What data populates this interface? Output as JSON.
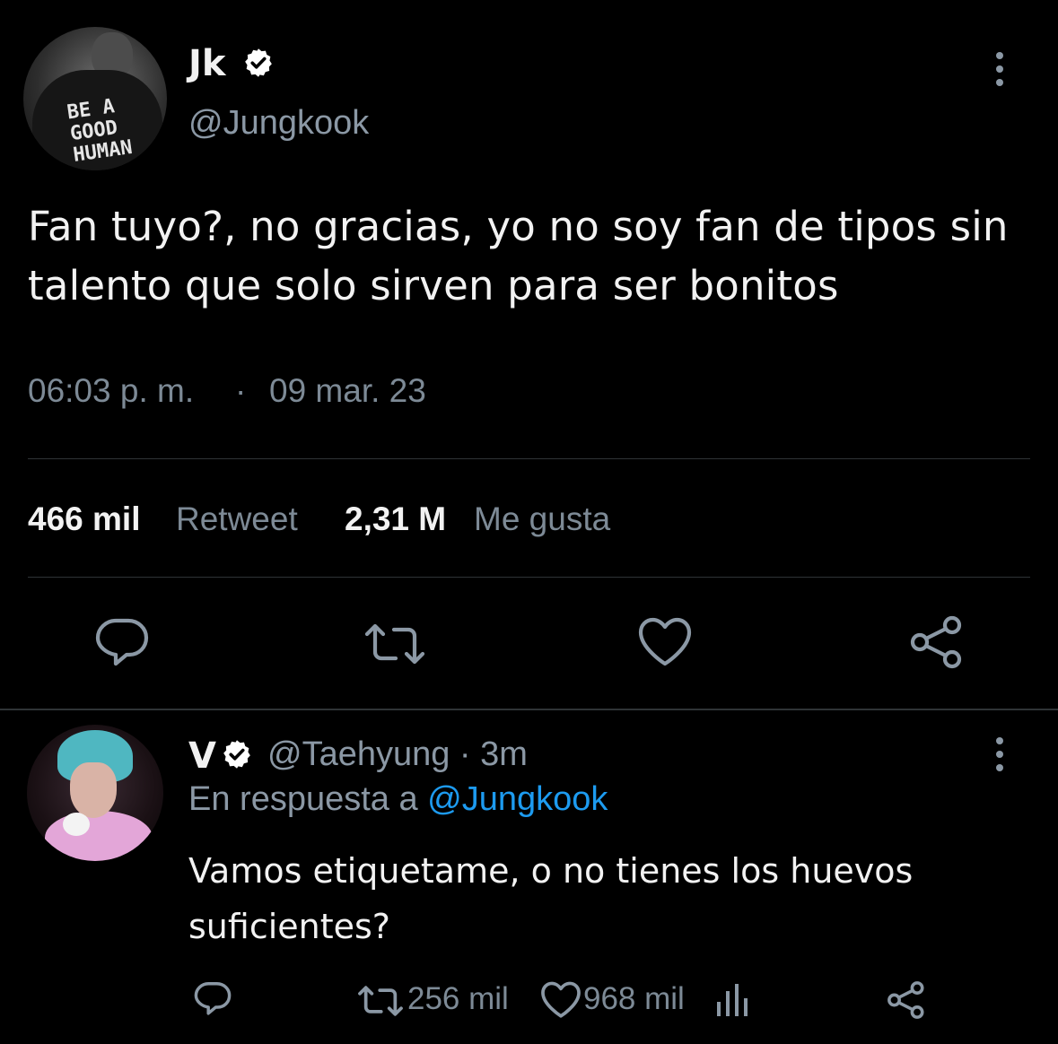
{
  "main_tweet": {
    "display_name": "Jk",
    "handle": "@Jungkook",
    "avatar_shirt_text": "BE A GOOD HUMAN",
    "text": "Fan tuyo?, no gracias, yo no soy fan de tipos sin talento que solo sirven para ser bonitos",
    "time": "06:03 p. m.",
    "separator": "·",
    "date": "09 mar. 23",
    "stats": {
      "retweets_count": "466 mil",
      "retweets_label": "Retweet",
      "likes_count": "2,31 M",
      "likes_label": "Me gusta"
    },
    "actions": [
      "reply-icon",
      "retweet-icon",
      "like-icon",
      "share-icon"
    ]
  },
  "reply_tweet": {
    "display_name": "V",
    "handle_time": "@Taehyung · 3m",
    "reply_prefix": "En respuesta a",
    "reply_to": "@Jungkook",
    "text": "Vamos etiquetame, o no tienes los huevos suficientes?",
    "retweets": "256 mil",
    "likes": "968 mil",
    "actions": [
      "reply-icon",
      "retweet-icon",
      "like-icon",
      "analytics-icon",
      "share-icon"
    ]
  },
  "colors": {
    "background": "#000000",
    "primary_text": "#f2f2f2",
    "secondary_text": "#8b98a5",
    "link": "#1d9bf0",
    "divider": "#2f3336",
    "verified_badge": "#ffffff"
  }
}
